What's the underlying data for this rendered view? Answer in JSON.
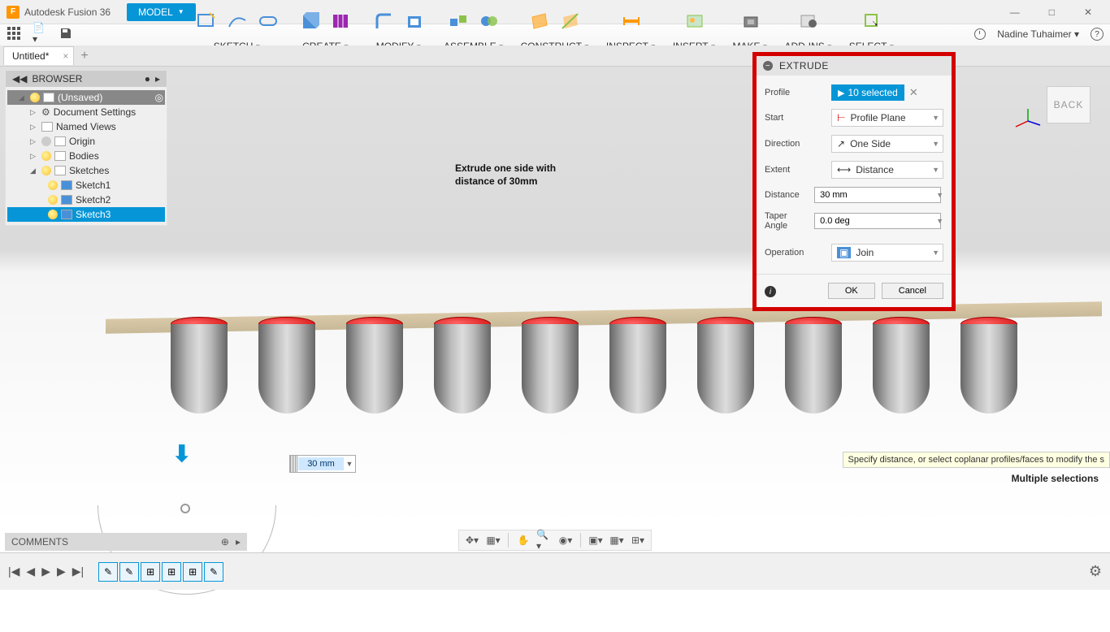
{
  "window": {
    "app_title": "Autodesk Fusion 36",
    "model_btn": "MODEL"
  },
  "user": {
    "name": "Nadine Tuhaimer"
  },
  "tabs": {
    "active": "Untitled*"
  },
  "ribbon": [
    {
      "label": "SKETCH"
    },
    {
      "label": "CREATE"
    },
    {
      "label": "MODIFY"
    },
    {
      "label": "ASSEMBLE"
    },
    {
      "label": "CONSTRUCT"
    },
    {
      "label": "INSPECT"
    },
    {
      "label": "INSERT"
    },
    {
      "label": "MAKE"
    },
    {
      "label": "ADD-INS"
    },
    {
      "label": "SELECT"
    }
  ],
  "browser": {
    "title": "BROWSER",
    "root": "(Unsaved)",
    "items": [
      {
        "label": "Document Settings"
      },
      {
        "label": "Named Views"
      },
      {
        "label": "Origin"
      },
      {
        "label": "Bodies"
      },
      {
        "label": "Sketches"
      },
      {
        "label": "Sketch1"
      },
      {
        "label": "Sketch2"
      },
      {
        "label": "Sketch3"
      }
    ]
  },
  "annotation": {
    "line1": "Extrude one side with",
    "line2": "distance of 30mm"
  },
  "viewcube": "BACK",
  "extrude": {
    "title": "EXTRUDE",
    "profile_lbl": "Profile",
    "profile_val": "10 selected",
    "start_lbl": "Start",
    "start_val": "Profile Plane",
    "direction_lbl": "Direction",
    "direction_val": "One Side",
    "extent_lbl": "Extent",
    "extent_val": "Distance",
    "distance_lbl": "Distance",
    "distance_val": "30 mm",
    "taper_lbl": "Taper Angle",
    "taper_val": "0.0 deg",
    "operation_lbl": "Operation",
    "operation_val": "Join",
    "ok": "OK",
    "cancel": "Cancel"
  },
  "float_input": "30 mm",
  "comments": "COMMENTS",
  "hint": "Specify distance, or select coplanar profiles/faces to modify the s",
  "multi": "Multiple selections"
}
